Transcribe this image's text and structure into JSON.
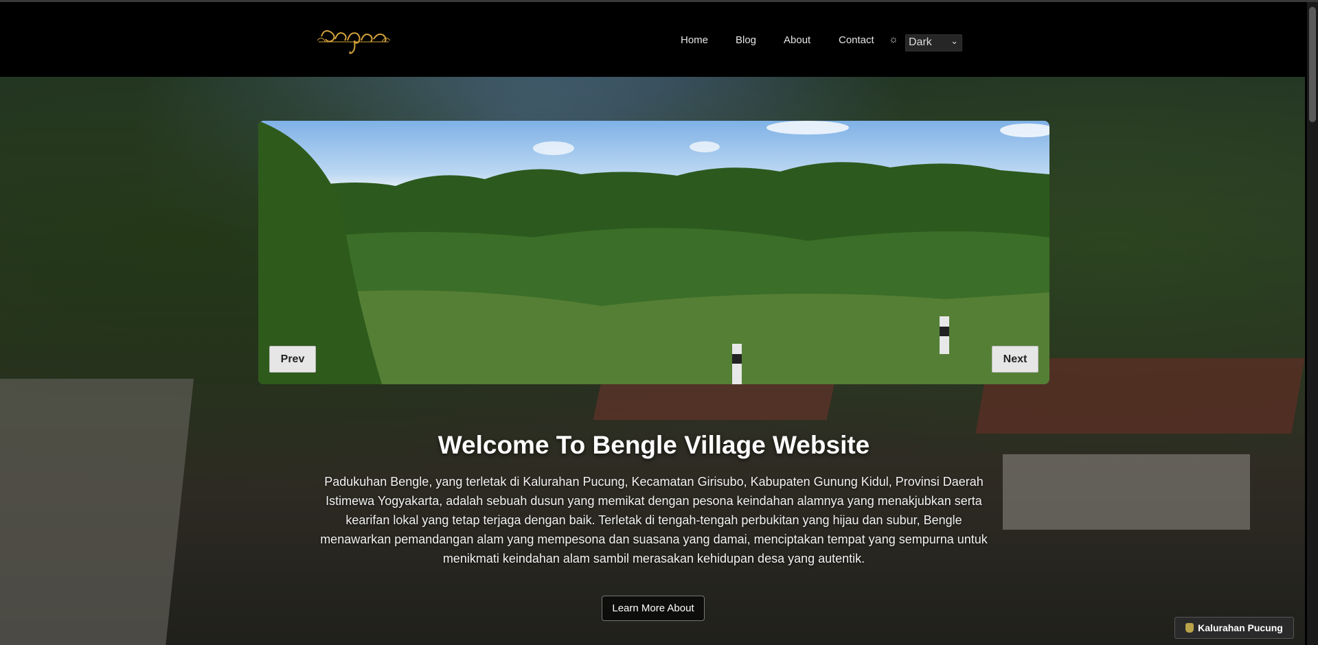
{
  "nav": {
    "logo_text": "ꦧꦼꦁꦒ꧀ꦭꦺ",
    "links": [
      "Home",
      "Blog",
      "About",
      "Contact"
    ],
    "theme_icon": "☼",
    "theme_value": "Dark"
  },
  "carousel": {
    "prev_label": "Prev",
    "next_label": "Next"
  },
  "hero": {
    "title": "Welcome To Bengle Village Website",
    "description": "Padukuhan Bengle, yang terletak di Kalurahan Pucung, Kecamatan Girisubo, Kabupaten Gunung Kidul, Provinsi Daerah Istimewa Yogyakarta, adalah sebuah dusun yang memikat dengan pesona keindahan alamnya yang menakjubkan serta kearifan lokal yang tetap terjaga dengan baik. Terletak di tengah-tengah perbukitan yang hijau dan subur, Bengle menawarkan pemandangan alam yang mempesona dan suasana yang damai, menciptakan tempat yang sempurna untuk menikmati keindahan alam sambil merasakan kehidupan desa yang autentik.",
    "button_label": "Learn More About"
  },
  "badge": {
    "label": "Kalurahan Pucung"
  },
  "colors": {
    "logo_gold": "#d4a33a",
    "navbar_bg": "#000000"
  }
}
